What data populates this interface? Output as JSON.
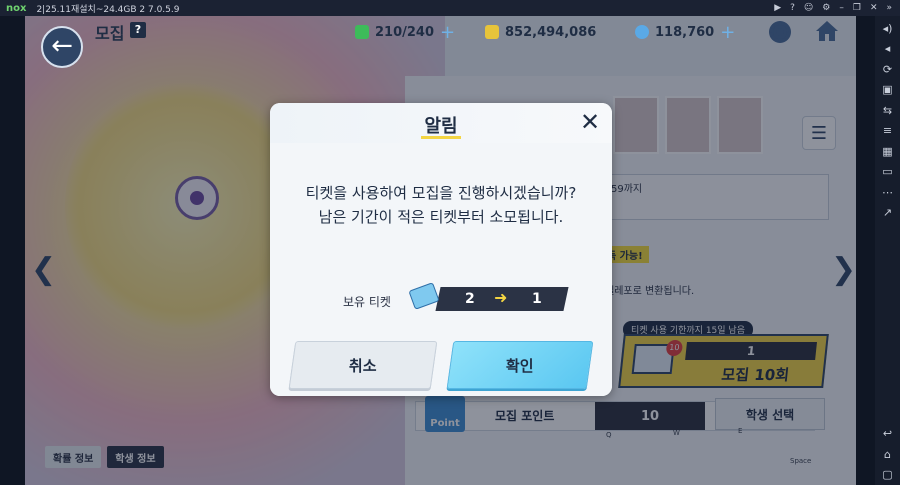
{
  "emulator": {
    "logo": "nox",
    "title": "2|25.11재설치~24.4GB 2 7.0.5.9"
  },
  "header": {
    "title": "모집",
    "help": "?",
    "stamina": "210/240",
    "credits": "852,494,086",
    "gems": "118,760"
  },
  "background": {
    "date_note": "59까지",
    "yellow_tag": "득 가능!",
    "convert_note": "엘레포로 변환됩니다.",
    "ticket_deadline": "티켓 사용 기한까지 15일 남음",
    "recruit10_count": "1",
    "recruit10_label": "모집 10회",
    "envelope_badge": "10",
    "point_badge": "Point",
    "point_label": "모집 포인트",
    "point_value": "10",
    "student_select": "학생 선택",
    "rate_info": "확률 정보",
    "student_info": "학생 정보",
    "key_q": "Q",
    "key_w": "W",
    "key_e": "E",
    "key_space": "Space"
  },
  "dialog": {
    "title": "알림",
    "close": "✕",
    "message_line1": "티켓을 사용하여 모집을 진행하시겠습니까?",
    "message_line2": "남은 기간이 적은 티켓부터 소모됩니다.",
    "ticket_label": "보유 티켓",
    "ticket_from": "2",
    "ticket_arrow": "➜",
    "ticket_to": "1",
    "cancel": "취소",
    "confirm": "확인"
  }
}
